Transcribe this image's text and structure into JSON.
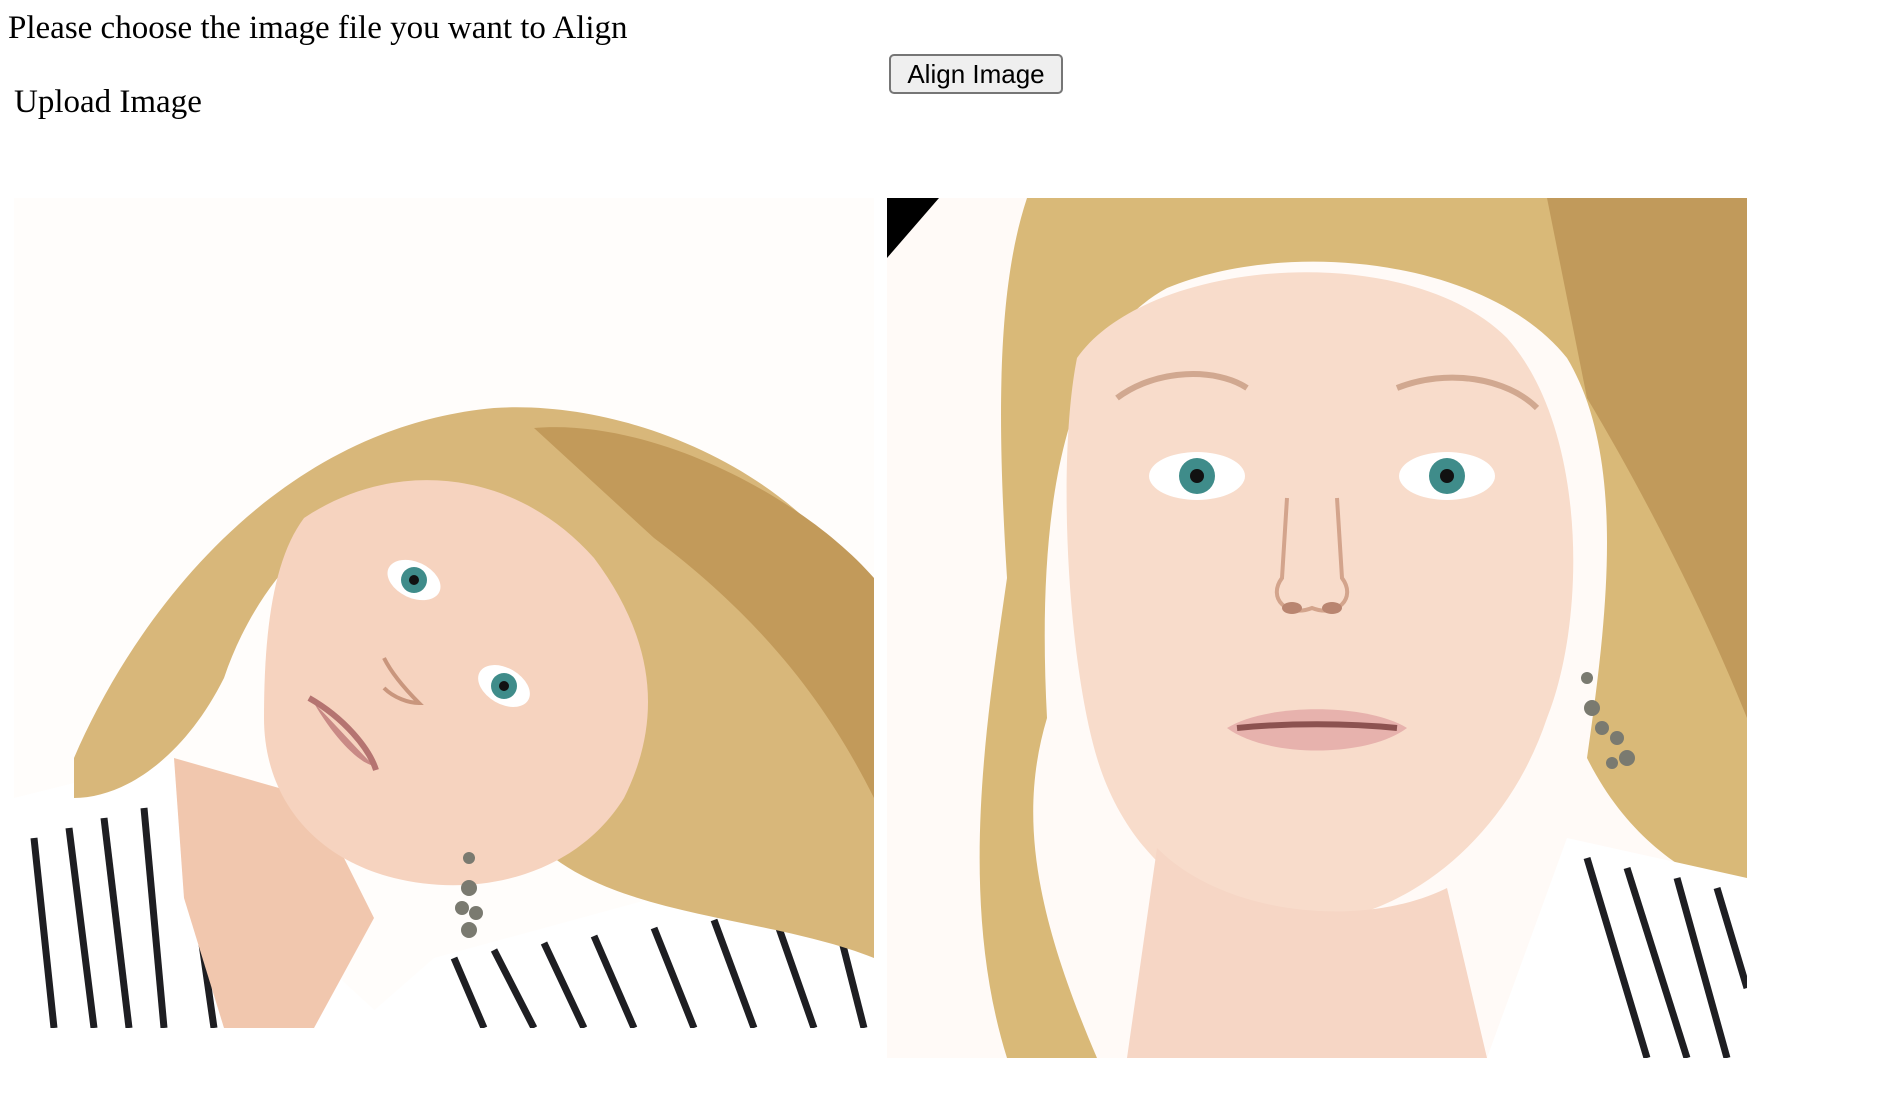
{
  "page": {
    "instruction": "Please choose the image file you want to Align",
    "upload_label": "Upload Image",
    "align_button_label": "Align Image"
  },
  "images": {
    "original": {
      "content": "photo of a blonde woman with tilted head and striped shirt"
    },
    "aligned": {
      "content": "rotated and cropped close-up of the same face, upright"
    }
  }
}
